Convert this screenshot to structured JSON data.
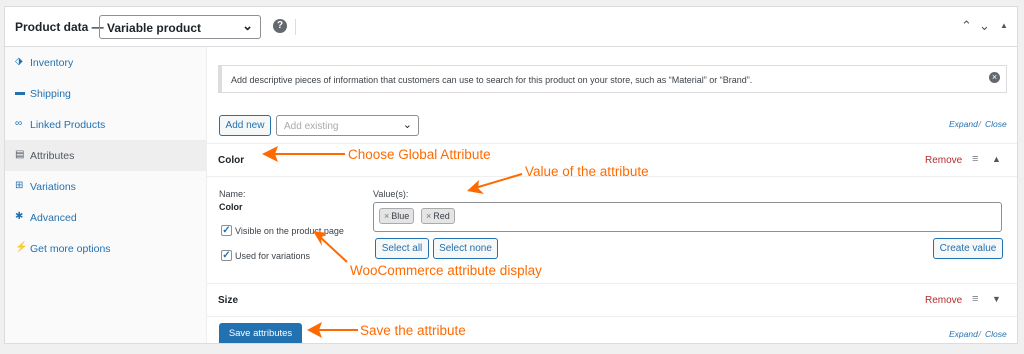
{
  "header": {
    "title": "Product data —",
    "product_type": "Variable product",
    "help_glyph": "?",
    "controls": [
      "⌃",
      "⌄",
      "▲"
    ]
  },
  "sidebar": {
    "tabs": [
      {
        "label": "Inventory",
        "icon": "tag-icon",
        "active": false
      },
      {
        "label": "Shipping",
        "icon": "truck-icon",
        "active": false
      },
      {
        "label": "Linked Products",
        "icon": "link-icon",
        "active": false
      },
      {
        "label": "Attributes",
        "icon": "list-icon",
        "active": true
      },
      {
        "label": "Variations",
        "icon": "grid-icon",
        "active": false
      },
      {
        "label": "Advanced",
        "icon": "gear-icon",
        "active": false
      },
      {
        "label": "Get more options",
        "icon": "plugin-icon",
        "active": false
      }
    ]
  },
  "notice": {
    "text": "Add descriptive pieces of information that customers can use to search for this product on your store, such as “Material” or “Brand”.",
    "dismiss_glyph": "×"
  },
  "toolbar": {
    "add_new": "Add new",
    "add_existing_placeholder": "Add existing",
    "expand": "Expand",
    "sep": " / ",
    "close": "Close"
  },
  "attributes": [
    {
      "name": "Color",
      "remove": "Remove",
      "name_label": "Name:",
      "values_label": "Value(s):",
      "values": [
        "Blue",
        "Red"
      ],
      "visible_label": "Visible on the product page",
      "visible_checked": true,
      "variations_label": "Used for variations",
      "variations_checked": true,
      "select_all": "Select all",
      "select_none": "Select none",
      "create_value": "Create value"
    },
    {
      "name": "Size",
      "remove": "Remove"
    }
  ],
  "footer": {
    "save": "Save attributes",
    "expand": "Expand",
    "sep": " / ",
    "close": "Close"
  },
  "annotations": {
    "choose_global": "Choose Global Attribute",
    "value_of": "Value of the attribute",
    "display": "WooCommerce attribute display",
    "save": "Save the attribute"
  },
  "colors": {
    "accent": "#2271b1",
    "remove": "#b32d2e",
    "annotation": "#ff6a00"
  }
}
